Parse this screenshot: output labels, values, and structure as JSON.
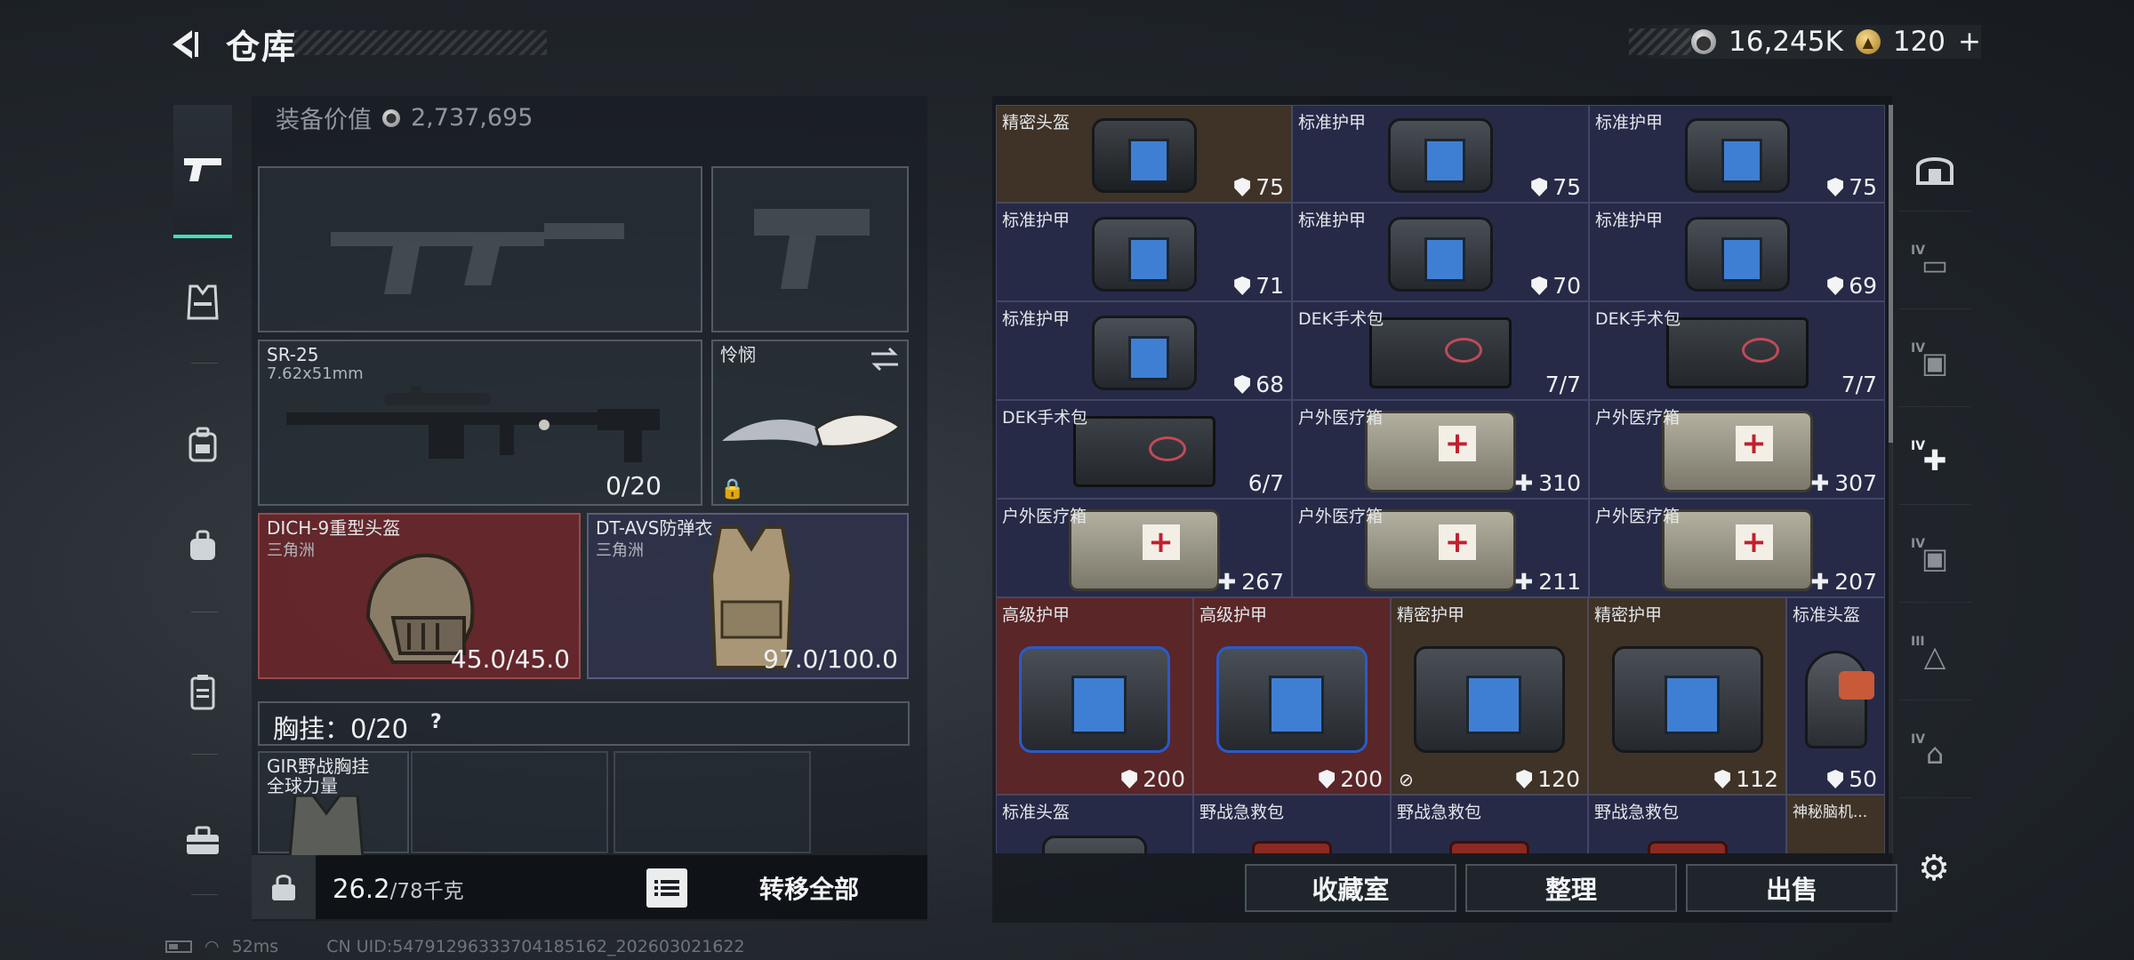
{
  "header": {
    "title": "仓库",
    "currency": {
      "silver_value": "16,245K",
      "gold_value": "120",
      "gold_add": "+"
    }
  },
  "equipment": {
    "value_label": "装备价值",
    "value": "2,737,695",
    "primary_weapon": {
      "name": "SR-25",
      "caliber": "7.62x51mm",
      "ammo": "0/20"
    },
    "melee": {
      "name": "怜悯"
    },
    "helmet": {
      "name": "DICH-9重型头盔",
      "faction": "三角洲",
      "durability": "45.0/45.0"
    },
    "armor": {
      "name": "DT-AVS防弹衣",
      "faction": "三角洲",
      "durability": "97.0/100.0"
    },
    "chest_rig_label": "胸挂：0/20",
    "chest_rig_help": "?",
    "chest_rig_item": {
      "name": "GIR野战胸挂",
      "faction": "全球力量"
    },
    "weight_value": "26.2",
    "weight_max": "/78千克",
    "transfer_all": "转移全部"
  },
  "stash": {
    "items": [
      {
        "name": "精密头盔",
        "value": "75",
        "icon": "shield"
      },
      {
        "name": "标准护甲",
        "value": "75",
        "icon": "shield"
      },
      {
        "name": "标准护甲",
        "value": "75",
        "icon": "shield"
      },
      {
        "name": "标准护甲",
        "value": "71",
        "icon": "shield"
      },
      {
        "name": "标准护甲",
        "value": "70",
        "icon": "shield"
      },
      {
        "name": "标准护甲",
        "value": "69",
        "icon": "shield"
      },
      {
        "name": "标准护甲",
        "value": "68",
        "icon": "shield"
      },
      {
        "name": "DEK手术包",
        "value": "7/7",
        "icon": ""
      },
      {
        "name": "DEK手术包",
        "value": "7/7",
        "icon": ""
      },
      {
        "name": "DEK手术包",
        "value": "6/7",
        "icon": ""
      },
      {
        "name": "户外医疗箱",
        "value": "310",
        "icon": "plus"
      },
      {
        "name": "户外医疗箱",
        "value": "307",
        "icon": "plus"
      },
      {
        "name": "户外医疗箱",
        "value": "267",
        "icon": "plus"
      },
      {
        "name": "户外医疗箱",
        "value": "211",
        "icon": "plus"
      },
      {
        "name": "户外医疗箱",
        "value": "207",
        "icon": "plus"
      },
      {
        "name": "高级护甲",
        "value": "200",
        "icon": "shield"
      },
      {
        "name": "高级护甲",
        "value": "200",
        "icon": "shield"
      },
      {
        "name": "精密护甲",
        "value": "120",
        "icon": "broken-shield"
      },
      {
        "name": "精密护甲",
        "value": "112",
        "icon": "shield"
      },
      {
        "name": "标准头盔",
        "value": "50",
        "icon": "shield"
      },
      {
        "name": "标准头盔",
        "value": "",
        "icon": ""
      },
      {
        "name": "野战急救包",
        "value": "",
        "icon": ""
      },
      {
        "name": "野战急救包",
        "value": "",
        "icon": ""
      },
      {
        "name": "野战急救包",
        "value": "",
        "icon": ""
      },
      {
        "name": "神秘脑机...",
        "value": "",
        "icon": ""
      }
    ]
  },
  "actions": {
    "collection": "收藏室",
    "organize": "整理",
    "sell": "出售"
  },
  "status_bar": {
    "ping": "52ms",
    "uid": "CN UID:547912963337041851​62_202603021622"
  },
  "colors": {
    "accent": "#3fe0b8",
    "rare_red": "#5a2628",
    "rare_brown": "#3f3226",
    "common_blue": "#262a47"
  }
}
